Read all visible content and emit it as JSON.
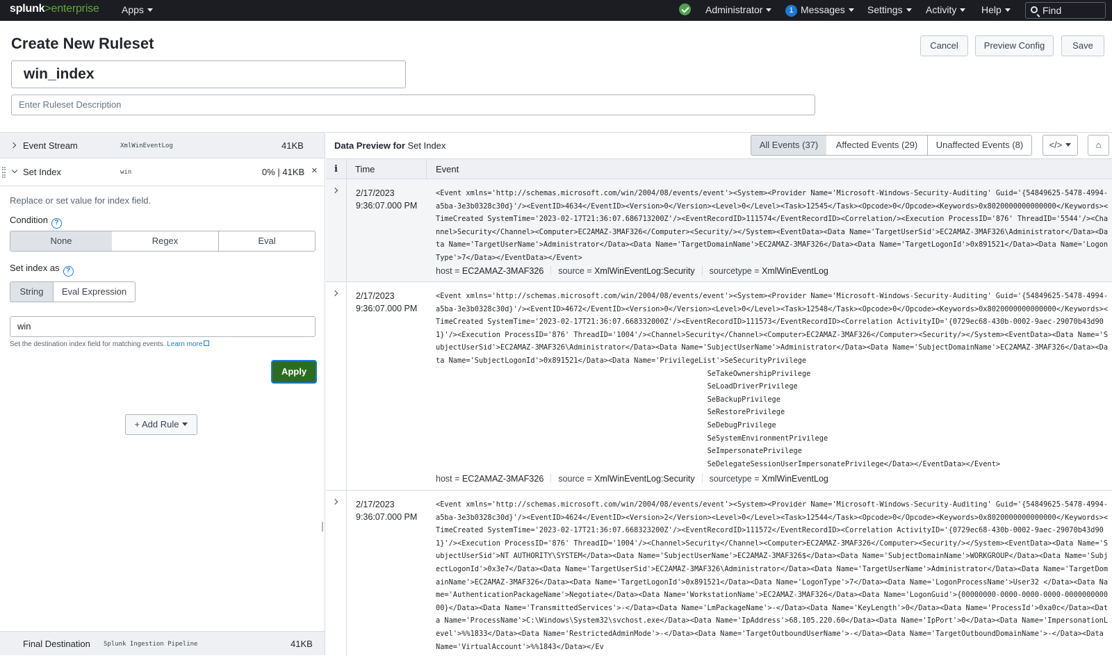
{
  "topbar": {
    "logo_main": "splunk",
    "logo_accent": ">enterprise",
    "apps": "Apps",
    "status_icon": "check-circle-icon",
    "user": "Administrator",
    "messages_count": "1",
    "messages": "Messages",
    "settings": "Settings",
    "activity": "Activity",
    "help": "Help",
    "find_placeholder": "Find"
  },
  "header": {
    "title": "Create New Ruleset",
    "cancel": "Cancel",
    "preview_config": "Preview Config",
    "save": "Save",
    "ruleset_name": "win_index",
    "description_placeholder": "Enter Ruleset Description"
  },
  "pipeline": {
    "event_stream": {
      "label": "Event Stream",
      "source": "XmlWinEventLog",
      "size": "41KB"
    },
    "set_index": {
      "label": "Set Index",
      "value": "win",
      "stats": "0% | 41KB"
    },
    "help_text": "Replace or set value for index field.",
    "condition_label": "Condition",
    "conditions": [
      "None",
      "Regex",
      "Eval"
    ],
    "condition_selected": "None",
    "set_index_as_label": "Set index as",
    "modes": [
      "String",
      "Eval Expression"
    ],
    "mode_selected": "String",
    "index_value": "win",
    "hint": "Set the destination index field for matching events.",
    "learn_more": "Learn more",
    "apply": "Apply",
    "add_rule": "+ Add Rule",
    "final_destination": {
      "label": "Final Destination",
      "target": "Splunk Ingestion Pipeline",
      "size": "41KB"
    }
  },
  "preview": {
    "title_bold": "Data Preview for",
    "title_rest": " Set Index",
    "tabs": [
      "All Events (37)",
      "Affected Events (29)",
      "Unaffected Events (8)"
    ],
    "tab_selected": "All Events (37)",
    "columns": {
      "info": "i",
      "time": "Time",
      "event": "Event"
    },
    "events": [
      {
        "time_date": "2/17/2023",
        "time_clock": "9:36:07.000 PM",
        "text": "<Event xmlns='http://schemas.microsoft.com/win/2004/08/events/event'><System><Provider Name='Microsoft-Windows-Security-Auditing' Guid='{54849625-5478-4994-a5ba-3e3b0328c30d}'/><EventID>4634</EventID><Version>0</Version><Level>0</Level><Task>12545</Task><Opcode>0</Opcode><Keywords>0x8020000000000000</Keywords><TimeCreated SystemTime='2023-02-17T21:36:07.686713200Z'/><EventRecordID>111574</EventRecordID><Correlation/><Execution ProcessID='876' ThreadID='5544'/><Channel>Security</Channel><Computer>EC2AMAZ-3MAF326</Computer><Security/></System><EventData><Data Name='TargetUserSid'>EC2AMAZ-3MAF326\\Administrator</Data><Data Name='TargetUserName'>Administrator</Data><Data Name='TargetDomainName'>EC2AMAZ-3MAF326</Data><Data Name='TargetLogonId'>0x891521</Data><Data Name='LogonType'>7</Data></EventData></Event>",
        "host": "EC2AMAZ-3MAF326",
        "source": "XmlWinEventLog:Security",
        "sourcetype": "XmlWinEventLog"
      },
      {
        "time_date": "2/17/2023",
        "time_clock": "9:36:07.000 PM",
        "text": "<Event xmlns='http://schemas.microsoft.com/win/2004/08/events/event'><System><Provider Name='Microsoft-Windows-Security-Auditing' Guid='{54849625-5478-4994-a5ba-3e3b0328c30d}'/><EventID>4672</EventID><Version>0</Version><Level>0</Level><Task>12548</Task><Opcode>0</Opcode><Keywords>0x8020000000000000</Keywords><TimeCreated SystemTime='2023-02-17T21:36:07.668332000Z'/><EventRecordID>111573</EventRecordID><Correlation ActivityID='{0729ec68-430b-0002-9aec-29070b43d901}'/><Execution ProcessID='876' ThreadID='1004'/><Channel>Security</Channel><Computer>EC2AMAZ-3MAF326</Computer><Security/></System><EventData><Data Name='SubjectUserSid'>EC2AMAZ-3MAF326\\Administrator</Data><Data Name='SubjectUserName'>Administrator</Data><Data Name='SubjectDomainName'>EC2AMAZ-3MAF326</Data><Data Name='SubjectLogonId'>0x891521</Data><Data Name='PrivilegeList'>SeSecurityPrivilege\n\t\t\tSeTakeOwnershipPrivilege\n\t\t\tSeLoadDriverPrivilege\n\t\t\tSeBackupPrivilege\n\t\t\tSeRestorePrivilege\n\t\t\tSeDebugPrivilege\n\t\t\tSeSystemEnvironmentPrivilege\n\t\t\tSeImpersonatePrivilege\n\t\t\tSeDelegateSessionUserImpersonatePrivilege</Data></EventData></Event>",
        "host": "EC2AMAZ-3MAF326",
        "source": "XmlWinEventLog:Security",
        "sourcetype": "XmlWinEventLog"
      },
      {
        "time_date": "2/17/2023",
        "time_clock": "9:36:07.000 PM",
        "text": "<Event xmlns='http://schemas.microsoft.com/win/2004/08/events/event'><System><Provider Name='Microsoft-Windows-Security-Auditing' Guid='{54849625-5478-4994-a5ba-3e3b0328c30d}'/><EventID>4624</EventID><Version>2</Version><Level>0</Level><Task>12544</Task><Opcode>0</Opcode><Keywords>0x8020000000000000</Keywords><TimeCreated SystemTime='2023-02-17T21:36:07.668323200Z'/><EventRecordID>111572</EventRecordID><Correlation ActivityID='{0729ec68-430b-0002-9aec-29070b43d901}'/><Execution ProcessID='876' ThreadID='1004'/><Channel>Security</Channel><Computer>EC2AMAZ-3MAF326</Computer><Security/></System><EventData><Data Name='SubjectUserSid'>NT AUTHORITY\\SYSTEM</Data><Data Name='SubjectUserName'>EC2AMAZ-3MAF326$</Data><Data Name='SubjectDomainName'>WORKGROUP</Data><Data Name='SubjectLogonId'>0x3e7</Data><Data Name='TargetUserSid'>EC2AMAZ-3MAF326\\Administrator</Data><Data Name='TargetUserName'>Administrator</Data><Data Name='TargetDomainName'>EC2AMAZ-3MAF326</Data><Data Name='TargetLogonId'>0x891521</Data><Data Name='LogonType'>7</Data><Data Name='LogonProcessName'>User32 </Data><Data Name='AuthenticationPackageName'>Negotiate</Data><Data Name='WorkstationName'>EC2AMAZ-3MAF326</Data><Data Name='LogonGuid'>{00000000-0000-0000-0000-000000000000}</Data><Data Name='TransmittedServices'>-</Data><Data Name='LmPackageName'>-</Data><Data Name='KeyLength'>0</Data><Data Name='ProcessId'>0xa0c</Data><Data Name='ProcessName'>C:\\Windows\\System32\\svchost.exe</Data><Data Name='IpAddress'>68.105.220.60</Data><Data Name='IpPort'>0</Data><Data Name='ImpersonationLevel'>%%1833</Data><Data Name='RestrictedAdminMode'>-</Data><Data Name='TargetOutboundUserName'>-</Data><Data Name='TargetOutboundDomainName'>-</Data><Data Name='VirtualAccount'>%%1843</Data></Ev",
        "host": "",
        "source": "",
        "sourcetype": ""
      }
    ],
    "field_labels": {
      "host": "host =",
      "source": "source =",
      "sourcetype": "sourcetype ="
    }
  }
}
